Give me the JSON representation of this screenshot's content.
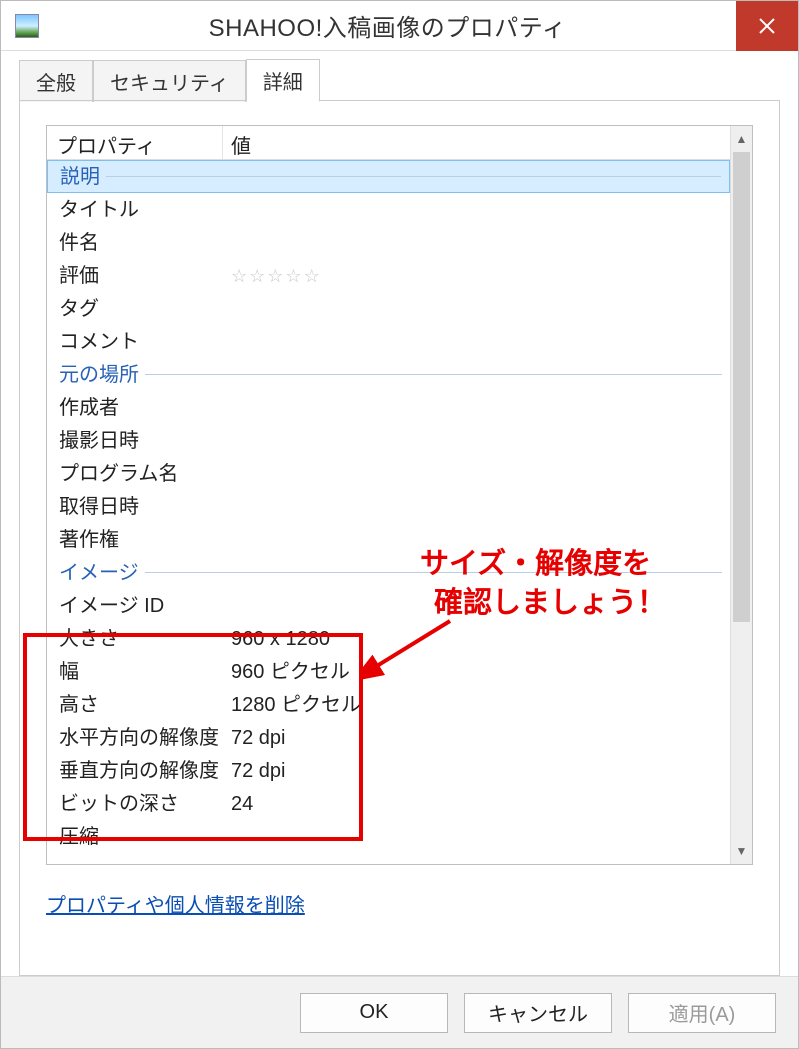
{
  "window": {
    "title": "SHAHOO!入稿画像のプロパティ"
  },
  "tabs": {
    "general": "全般",
    "security": "セキュリティ",
    "details": "詳細"
  },
  "columns": {
    "property": "プロパティ",
    "value": "値"
  },
  "groups": {
    "description": "説明",
    "origin": "元の場所",
    "image": "イメージ"
  },
  "props": {
    "title": "タイトル",
    "subject": "件名",
    "rating": "評価",
    "tags": "タグ",
    "comments": "コメント",
    "authors": "作成者",
    "dateTaken": "撮影日時",
    "program": "プログラム名",
    "dateAcquired": "取得日時",
    "copyright": "著作権",
    "imageId": "イメージ ID",
    "dimensions": "大きさ",
    "width": "幅",
    "height": "高さ",
    "hRes": "水平方向の解像度",
    "vRes": "垂直方向の解像度",
    "bitDepth": "ビットの深さ",
    "compression": "圧縮"
  },
  "values": {
    "dimensions": "960 x 1280",
    "width": "960 ピクセル",
    "height": "1280 ピクセル",
    "hRes": "72 dpi",
    "vRes": "72 dpi",
    "bitDepth": "24"
  },
  "link": {
    "removeProps": "プロパティや個人情報を削除"
  },
  "buttons": {
    "ok": "OK",
    "cancel": "キャンセル",
    "apply": "適用(A)"
  },
  "annotation": {
    "line1": "サイズ・解像度を",
    "line2": "確認しましょう！"
  }
}
